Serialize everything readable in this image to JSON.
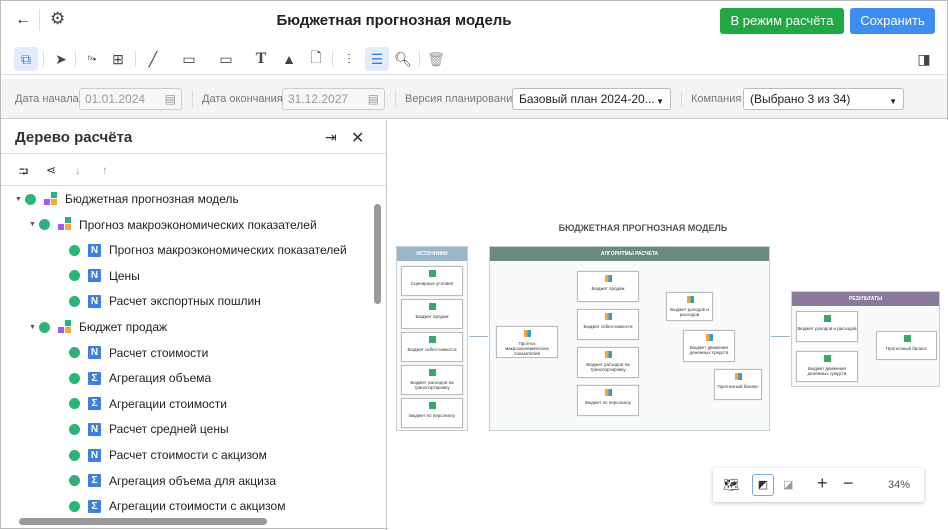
{
  "header": {
    "title": "Бюджетная прогнозная модель",
    "calc_mode_button": "В режим расчёта",
    "save_button": "Сохранить",
    "colors": {
      "calc": "#21a845",
      "save": "#3d8ef0"
    }
  },
  "toolbar": {
    "icons": [
      "structure-icon",
      "select-pointer-icon",
      "formula-icon",
      "add-block-icon",
      "line-icon",
      "rectangle-icon",
      "callout-icon",
      "text-icon",
      "image-icon",
      "document-icon",
      "settings-sliders-icon",
      "toggle-icon",
      "search-icon",
      "delete-icon",
      "panel-icon"
    ]
  },
  "filters": {
    "start_label": "Дата начала",
    "start_value": "01.01.2024",
    "end_label": "Дата окончания",
    "end_value": "31.12.2027",
    "version_label": "Версия планирования",
    "version_value": "Базовый план 2024-20...",
    "company_label": "Компания",
    "company_value": "(Выбрано 3 из 34)"
  },
  "tree": {
    "title": "Дерево расчёта",
    "items": [
      {
        "label": "Бюджетная прогнозная модель",
        "type": "model",
        "level": 0
      },
      {
        "label": "Прогноз макроэкономических показателей",
        "type": "model",
        "level": 1
      },
      {
        "label": "Прогноз макроэкономических показателей",
        "type": "calc",
        "level": 2
      },
      {
        "label": "Цены",
        "type": "calc",
        "level": 2
      },
      {
        "label": "Расчет экспортных пошлин",
        "type": "calc",
        "level": 2
      },
      {
        "label": "Бюджет продаж",
        "type": "model",
        "level": 1
      },
      {
        "label": "Расчет стоимости",
        "type": "calc",
        "level": 2
      },
      {
        "label": "Агрегация объема",
        "type": "sum",
        "level": 2
      },
      {
        "label": "Агрегации стоимости",
        "type": "sum",
        "level": 2
      },
      {
        "label": "Расчет средней цены",
        "type": "calc",
        "level": 2
      },
      {
        "label": "Расчет стоимости с акцизом",
        "type": "calc",
        "level": 2
      },
      {
        "label": "Агрегация объема для акциза",
        "type": "sum",
        "level": 2
      },
      {
        "label": "Агрегации стоимости с акцизом",
        "type": "sum",
        "level": 2
      }
    ]
  },
  "diagram": {
    "title": "БЮДЖЕТНАЯ ПРОГНОЗНАЯ МОДЕЛЬ",
    "sources": {
      "header": "ИСТОЧНИКИ",
      "items": [
        "Сценарные условия",
        "Бюджет продаж",
        "Бюджет себестоимости",
        "Бюджет расходов на транспортировку",
        "Бюджет по персоналу"
      ]
    },
    "algorithms": {
      "header": "АЛГОРИТМЫ РАСЧЕТА",
      "macro": "Прогноз макроэкономических показателей",
      "middle": [
        "Бюджет продаж",
        "Бюджет себестоимости",
        "Бюджет расходов на транспортировку",
        "Бюджет по персоналу"
      ],
      "income": "Бюджет доходов и расходов",
      "cash": "Бюджет движения денежных средств",
      "balance": "Прогнозный баланс"
    },
    "results": {
      "header": "РЕЗУЛЬТАТЫ",
      "income": "Бюджет доходов и расходов",
      "cash": "Бюджет движения денежных средств",
      "balance": "Прогнозный баланс"
    }
  },
  "zoom": {
    "value": "34%"
  }
}
